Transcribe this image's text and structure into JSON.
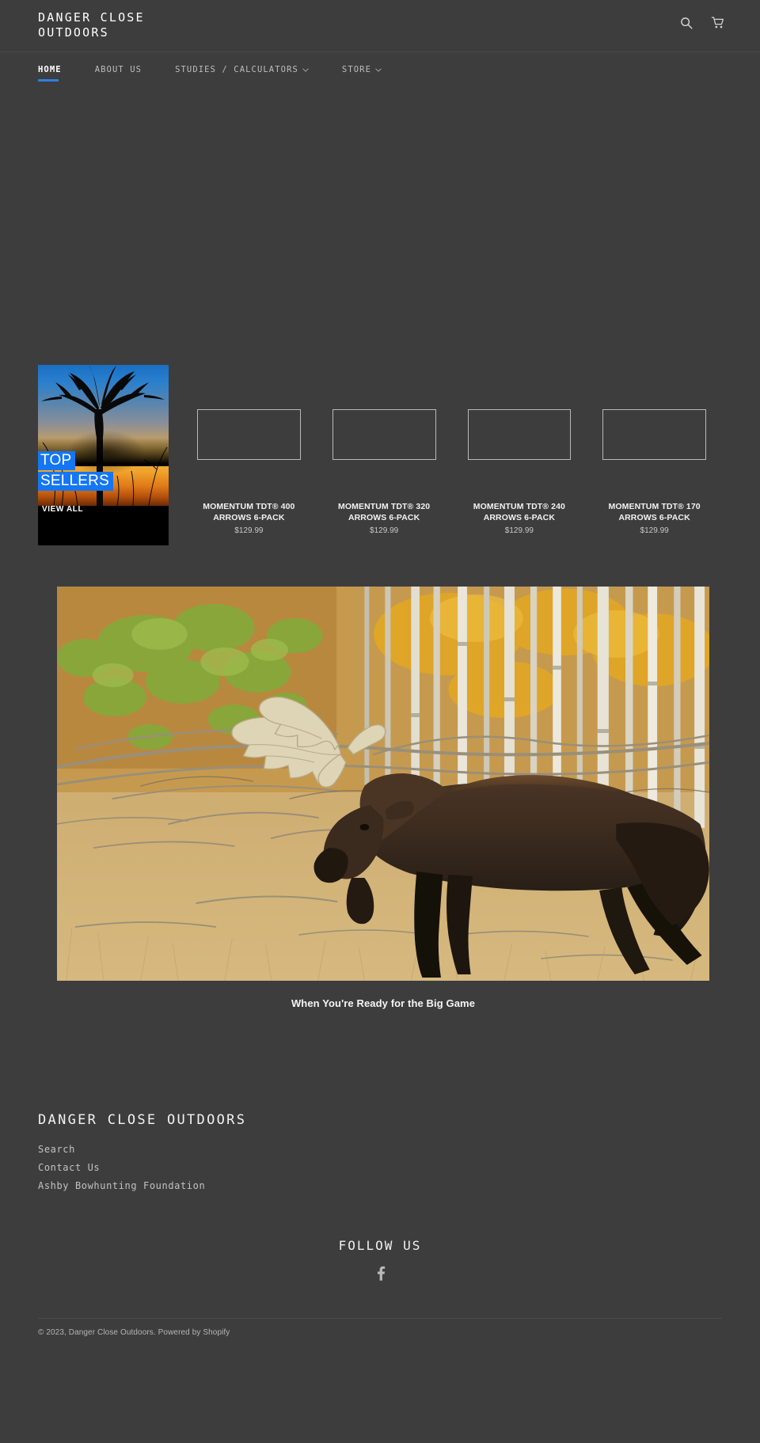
{
  "theme": {
    "background": "#3d3d3d",
    "accent": "#2e7fe0",
    "highlight": "#1476f2",
    "text": "#f2f2f2",
    "muted": "#c2c2c2"
  },
  "header": {
    "logo": "DANGER CLOSE OUTDOORS",
    "icons": [
      {
        "name": "search-icon",
        "label": "Search"
      },
      {
        "name": "cart-icon",
        "label": "Cart"
      }
    ]
  },
  "nav": {
    "items": [
      {
        "label": "HOME",
        "active": true,
        "has_caret": false
      },
      {
        "label": "ABOUT US",
        "active": false,
        "has_caret": false
      },
      {
        "label": "STUDIES / CALCULATORS",
        "active": false,
        "has_caret": true
      },
      {
        "label": "STORE",
        "active": false,
        "has_caret": true
      }
    ],
    "caret": "⌄"
  },
  "promo": {
    "title": "TOP SELLERS",
    "title_line1": "TOP",
    "title_line2": "SELLERS",
    "cta": "VIEW ALL"
  },
  "products": [
    {
      "title": "MOMENTUM TDT® 400 ARROWS 6-PACK",
      "price": "$129.99"
    },
    {
      "title": "MOMENTUM TDT® 320 ARROWS 6-PACK",
      "price": "$129.99"
    },
    {
      "title": "MOMENTUM TDT® 240 ARROWS 6-PACK",
      "price": "$129.99"
    },
    {
      "title": "MOMENTUM TDT® 170 ARROWS 6-PACK",
      "price": "$129.99"
    }
  ],
  "banner": {
    "caption": "When You're Ready for the Big Game",
    "image_alt": "bull moose in autumn aspen forest"
  },
  "footer": {
    "logo": "DANGER CLOSE OUTDOORS",
    "links": [
      {
        "label": "Search"
      },
      {
        "label": "Contact Us"
      },
      {
        "label": "Ashby Bowhunting Foundation"
      }
    ],
    "follow_title": "FOLLOW US",
    "social": [
      {
        "name": "facebook-icon",
        "glyph": "f"
      }
    ],
    "copyright": "© 2023, Danger Close Outdoors. Powered by Shopify"
  }
}
